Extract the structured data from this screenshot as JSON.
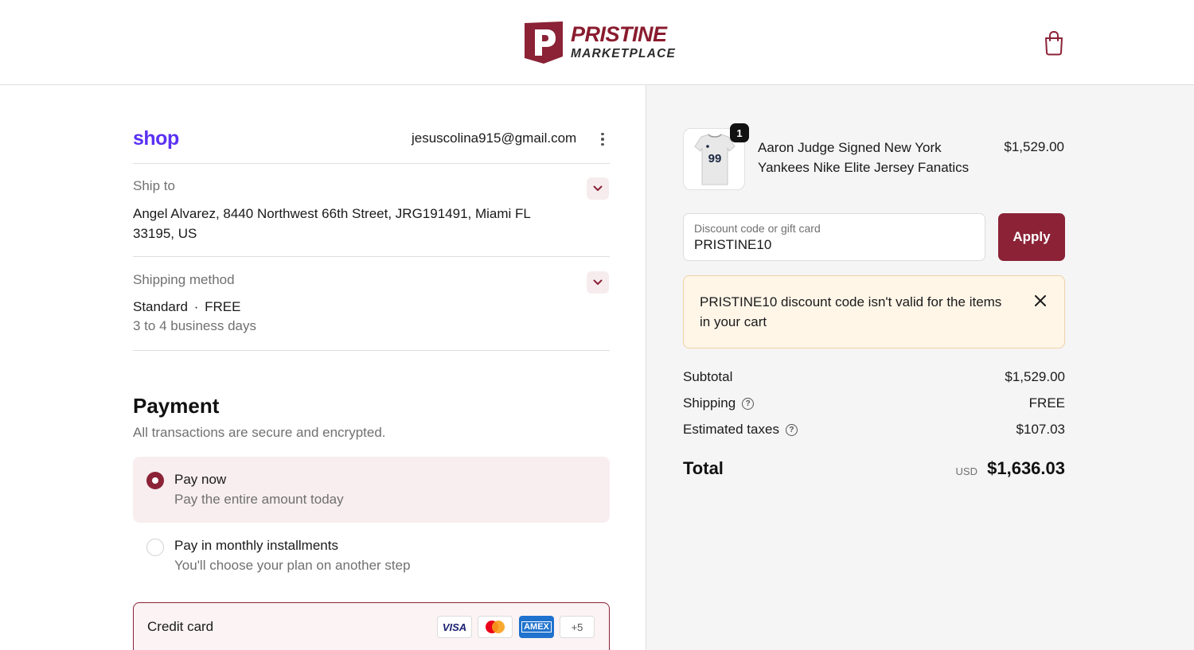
{
  "brand": {
    "name_line1": "PRISTINE",
    "name_line2": "MARKETPLACE",
    "logo_letter": "P",
    "accent_color": "#8b2236"
  },
  "header": {
    "cart_icon": "shopping-bag-icon"
  },
  "account": {
    "shop_logo": "shop",
    "email": "jesuscolina915@gmail.com"
  },
  "ship_to": {
    "label": "Ship to",
    "address_line1": "Angel Alvarez, 8440 Northwest 66th Street, JRG191491, Miami FL",
    "address_line2": "33195, US"
  },
  "shipping_method": {
    "label": "Shipping method",
    "name": "Standard",
    "separator": "·",
    "price": "FREE",
    "eta": "3 to 4 business days"
  },
  "payment": {
    "title": "Payment",
    "subtitle": "All transactions are secure and encrypted.",
    "options": [
      {
        "title": "Pay now",
        "subtitle": "Pay the entire amount today",
        "selected": true
      },
      {
        "title": "Pay in monthly installments",
        "subtitle": "You'll choose your plan on another step",
        "selected": false
      }
    ],
    "credit_card": {
      "label": "Credit card",
      "brands": [
        "VISA",
        "mastercard",
        "AMEX"
      ],
      "more": "+5"
    }
  },
  "cart": {
    "items": [
      {
        "quantity": "1",
        "name_line1": "Aaron Judge Signed New York",
        "name_line2": "Yankees Nike Elite Jersey Fanatics",
        "price": "$1,529.00",
        "jersey_number": "99"
      }
    ]
  },
  "discount": {
    "placeholder": "Discount code or gift card",
    "value": "PRISTINE10",
    "apply_label": "Apply"
  },
  "alert": {
    "code": "PRISTINE10",
    "message": " discount code isn't valid for the items in your cart"
  },
  "summary": {
    "subtotal_label": "Subtotal",
    "subtotal_value": "$1,529.00",
    "shipping_label": "Shipping",
    "shipping_value": "FREE",
    "taxes_label": "Estimated taxes",
    "taxes_value": "$107.03",
    "total_label": "Total",
    "currency": "USD",
    "total_value": "$1,636.03"
  }
}
